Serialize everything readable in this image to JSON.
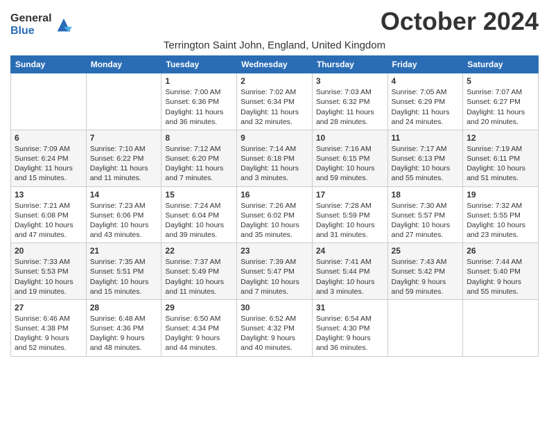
{
  "header": {
    "logo_general": "General",
    "logo_blue": "Blue",
    "month_title": "October 2024",
    "subtitle": "Terrington Saint John, England, United Kingdom"
  },
  "days_of_week": [
    "Sunday",
    "Monday",
    "Tuesday",
    "Wednesday",
    "Thursday",
    "Friday",
    "Saturday"
  ],
  "weeks": [
    [
      {
        "day": "",
        "info": ""
      },
      {
        "day": "",
        "info": ""
      },
      {
        "day": "1",
        "info": "Sunrise: 7:00 AM\nSunset: 6:36 PM\nDaylight: 11 hours and 36 minutes."
      },
      {
        "day": "2",
        "info": "Sunrise: 7:02 AM\nSunset: 6:34 PM\nDaylight: 11 hours and 32 minutes."
      },
      {
        "day": "3",
        "info": "Sunrise: 7:03 AM\nSunset: 6:32 PM\nDaylight: 11 hours and 28 minutes."
      },
      {
        "day": "4",
        "info": "Sunrise: 7:05 AM\nSunset: 6:29 PM\nDaylight: 11 hours and 24 minutes."
      },
      {
        "day": "5",
        "info": "Sunrise: 7:07 AM\nSunset: 6:27 PM\nDaylight: 11 hours and 20 minutes."
      }
    ],
    [
      {
        "day": "6",
        "info": "Sunrise: 7:09 AM\nSunset: 6:24 PM\nDaylight: 11 hours and 15 minutes."
      },
      {
        "day": "7",
        "info": "Sunrise: 7:10 AM\nSunset: 6:22 PM\nDaylight: 11 hours and 11 minutes."
      },
      {
        "day": "8",
        "info": "Sunrise: 7:12 AM\nSunset: 6:20 PM\nDaylight: 11 hours and 7 minutes."
      },
      {
        "day": "9",
        "info": "Sunrise: 7:14 AM\nSunset: 6:18 PM\nDaylight: 11 hours and 3 minutes."
      },
      {
        "day": "10",
        "info": "Sunrise: 7:16 AM\nSunset: 6:15 PM\nDaylight: 10 hours and 59 minutes."
      },
      {
        "day": "11",
        "info": "Sunrise: 7:17 AM\nSunset: 6:13 PM\nDaylight: 10 hours and 55 minutes."
      },
      {
        "day": "12",
        "info": "Sunrise: 7:19 AM\nSunset: 6:11 PM\nDaylight: 10 hours and 51 minutes."
      }
    ],
    [
      {
        "day": "13",
        "info": "Sunrise: 7:21 AM\nSunset: 6:08 PM\nDaylight: 10 hours and 47 minutes."
      },
      {
        "day": "14",
        "info": "Sunrise: 7:23 AM\nSunset: 6:06 PM\nDaylight: 10 hours and 43 minutes."
      },
      {
        "day": "15",
        "info": "Sunrise: 7:24 AM\nSunset: 6:04 PM\nDaylight: 10 hours and 39 minutes."
      },
      {
        "day": "16",
        "info": "Sunrise: 7:26 AM\nSunset: 6:02 PM\nDaylight: 10 hours and 35 minutes."
      },
      {
        "day": "17",
        "info": "Sunrise: 7:28 AM\nSunset: 5:59 PM\nDaylight: 10 hours and 31 minutes."
      },
      {
        "day": "18",
        "info": "Sunrise: 7:30 AM\nSunset: 5:57 PM\nDaylight: 10 hours and 27 minutes."
      },
      {
        "day": "19",
        "info": "Sunrise: 7:32 AM\nSunset: 5:55 PM\nDaylight: 10 hours and 23 minutes."
      }
    ],
    [
      {
        "day": "20",
        "info": "Sunrise: 7:33 AM\nSunset: 5:53 PM\nDaylight: 10 hours and 19 minutes."
      },
      {
        "day": "21",
        "info": "Sunrise: 7:35 AM\nSunset: 5:51 PM\nDaylight: 10 hours and 15 minutes."
      },
      {
        "day": "22",
        "info": "Sunrise: 7:37 AM\nSunset: 5:49 PM\nDaylight: 10 hours and 11 minutes."
      },
      {
        "day": "23",
        "info": "Sunrise: 7:39 AM\nSunset: 5:47 PM\nDaylight: 10 hours and 7 minutes."
      },
      {
        "day": "24",
        "info": "Sunrise: 7:41 AM\nSunset: 5:44 PM\nDaylight: 10 hours and 3 minutes."
      },
      {
        "day": "25",
        "info": "Sunrise: 7:43 AM\nSunset: 5:42 PM\nDaylight: 9 hours and 59 minutes."
      },
      {
        "day": "26",
        "info": "Sunrise: 7:44 AM\nSunset: 5:40 PM\nDaylight: 9 hours and 55 minutes."
      }
    ],
    [
      {
        "day": "27",
        "info": "Sunrise: 6:46 AM\nSunset: 4:38 PM\nDaylight: 9 hours and 52 minutes."
      },
      {
        "day": "28",
        "info": "Sunrise: 6:48 AM\nSunset: 4:36 PM\nDaylight: 9 hours and 48 minutes."
      },
      {
        "day": "29",
        "info": "Sunrise: 6:50 AM\nSunset: 4:34 PM\nDaylight: 9 hours and 44 minutes."
      },
      {
        "day": "30",
        "info": "Sunrise: 6:52 AM\nSunset: 4:32 PM\nDaylight: 9 hours and 40 minutes."
      },
      {
        "day": "31",
        "info": "Sunrise: 6:54 AM\nSunset: 4:30 PM\nDaylight: 9 hours and 36 minutes."
      },
      {
        "day": "",
        "info": ""
      },
      {
        "day": "",
        "info": ""
      }
    ]
  ]
}
